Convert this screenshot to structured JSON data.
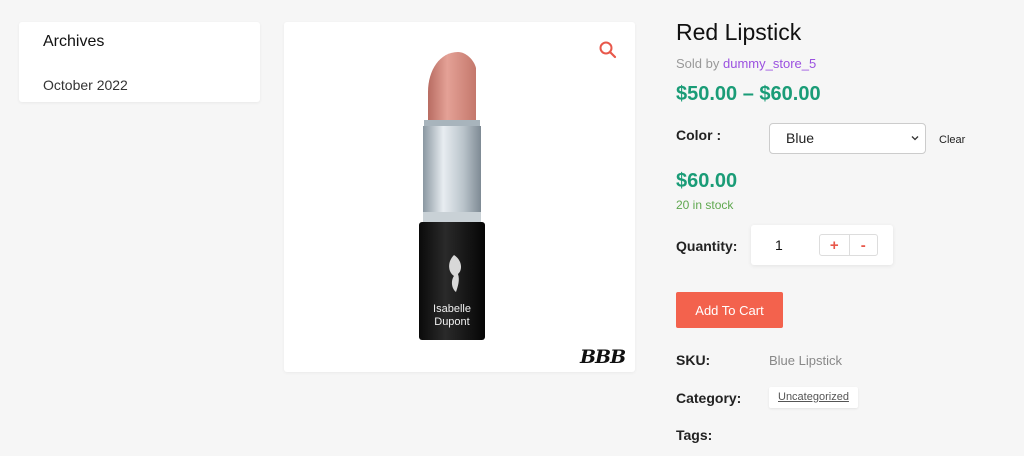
{
  "sidebar": {
    "archives_title": "Archives",
    "archive_link": "October 2022"
  },
  "image": {
    "zoom_icon": "search-icon",
    "product_photo": "lipstick-photo",
    "lipstick_brand_lines": [
      "Isabelle",
      "Dupont"
    ],
    "watermark": "BBB"
  },
  "product": {
    "title": "Red Lipstick",
    "sold_by_label": "Sold by",
    "vendor": "dummy_store_5",
    "price_range": "$50.00 – $60.00",
    "color_label": "Color :",
    "color_selected": "Blue",
    "clear_label": "Clear",
    "variation_price": "$60.00",
    "stock": "20 in stock",
    "quantity_label": "Quantity:",
    "quantity": "1",
    "plus": "+",
    "minus": "-",
    "add_to_cart": "Add To Cart"
  },
  "meta": {
    "sku_label": "SKU:",
    "sku_value": "Blue Lipstick",
    "category_label": "Category:",
    "category_value": "Uncategorized",
    "tags_label": "Tags:"
  },
  "colors": {
    "accent": "#f3624d",
    "price": "#1a9c77",
    "stock": "#5fa84f",
    "vendor": "#9b51e0"
  }
}
